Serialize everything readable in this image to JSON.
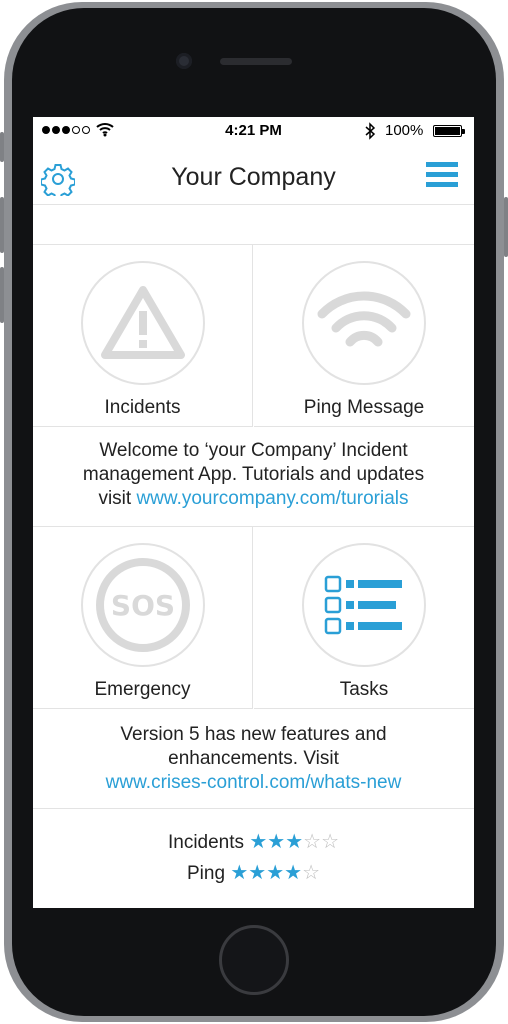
{
  "status_bar": {
    "time": "4:21 PM",
    "battery": "100%"
  },
  "header": {
    "title": "Your Company"
  },
  "tiles": [
    {
      "label": "Incidents",
      "icon": "warning-triangle-icon"
    },
    {
      "label": "Ping Message",
      "icon": "wifi-signal-icon"
    },
    {
      "label": "Emergency",
      "icon": "sos-icon"
    },
    {
      "label": "Tasks",
      "icon": "task-list-icon"
    }
  ],
  "welcome": {
    "line1": "Welcome to ‘your Company’ Incident",
    "line2": "management App. Tutorials and updates",
    "prefix": "visit ",
    "link": "www.yourcompany.com/turorials"
  },
  "version": {
    "line1": "Version 5 has new features and",
    "line2": "enhancements. Visit",
    "link": "www.crises-control.com/whats-new"
  },
  "ratings": [
    {
      "label": "Incidents",
      "stars": 3,
      "max": 5
    },
    {
      "label": "Ping",
      "stars": 4,
      "max": 5
    }
  ],
  "colors": {
    "accent": "#2a9fd6",
    "icon_gray": "#d9d9d9"
  }
}
